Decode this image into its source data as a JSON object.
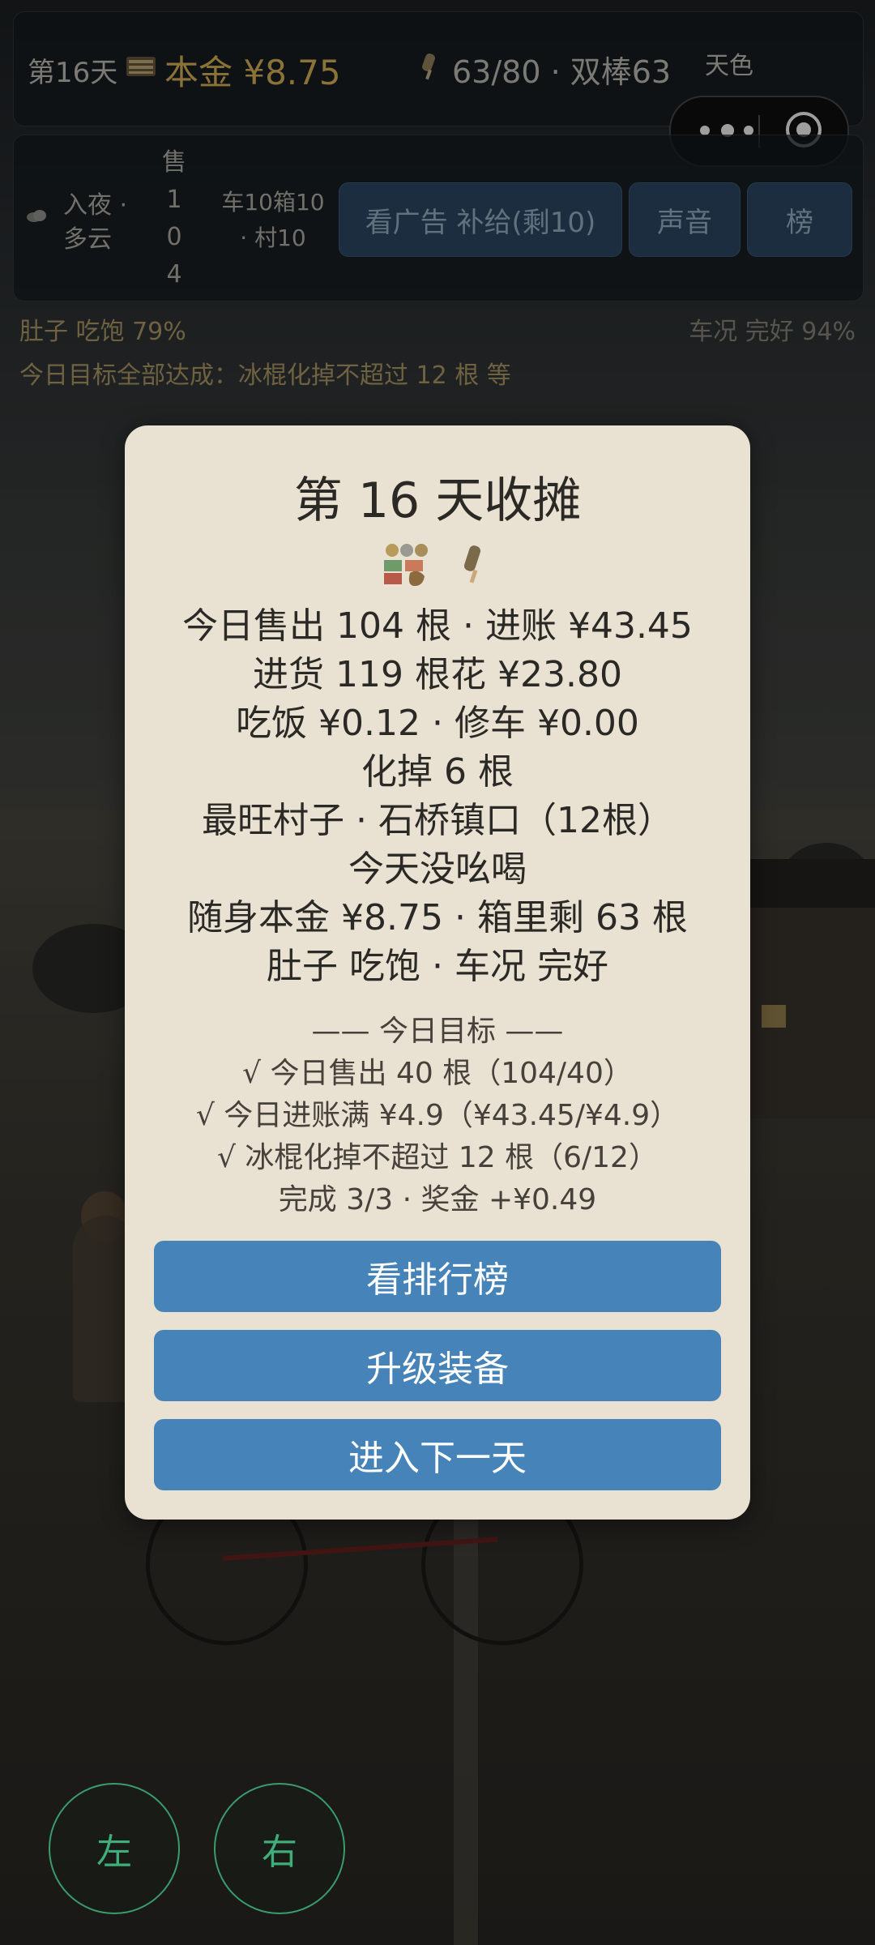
{
  "hud": {
    "day": "第16天",
    "money": "本金 ¥8.75",
    "stock": "63/80 · 双棒63",
    "sky_label": "天色",
    "weather_time": "入夜 ·",
    "weather_desc": "多云",
    "sold_chars": [
      "售",
      "1",
      "0",
      "4"
    ],
    "supply_line1": "车10箱10",
    "supply_line2": "· 村10",
    "ad_button": "看广告 补给(剩10)",
    "sound_button": "声音",
    "rank_button": "榜",
    "hunger": "肚子 吃饱 79%",
    "bike_condition": "车况 完好 94%",
    "goal_banner": "今日目标全部达成：冰棍化掉不超过 12 根 等"
  },
  "modal": {
    "title": "第 16 天收摊",
    "lines": [
      "今日售出 104 根 · 进账 ¥43.45",
      "进货 119 根花 ¥23.80",
      "吃饭 ¥0.12 · 修车 ¥0.00",
      "化掉 6 根",
      "最旺村子 · 石桥镇口（12根）",
      "今天没吆喝",
      "随身本金 ¥8.75 · 箱里剩 63 根",
      "肚子 吃饱 · 车况 完好"
    ],
    "goals_header": "—— 今日目标 ——",
    "goals": [
      "√ 今日售出 40 根（104/40）",
      "√ 今日进账满 ¥4.9（¥43.45/¥4.9）",
      "√ 冰棍化掉不超过 12 根（6/12）",
      "完成 3/3 · 奖金 +¥0.49"
    ],
    "buttons": {
      "leaderboard": "看排行榜",
      "upgrade": "升级装备",
      "next_day": "进入下一天"
    }
  },
  "controls": {
    "left": "左",
    "right": "右"
  },
  "colors": {
    "accent_gold": "#e0b85a",
    "button_blue": "#4683b9",
    "modal_bg": "#e9e2d3",
    "control_green": "#3fae7a"
  }
}
